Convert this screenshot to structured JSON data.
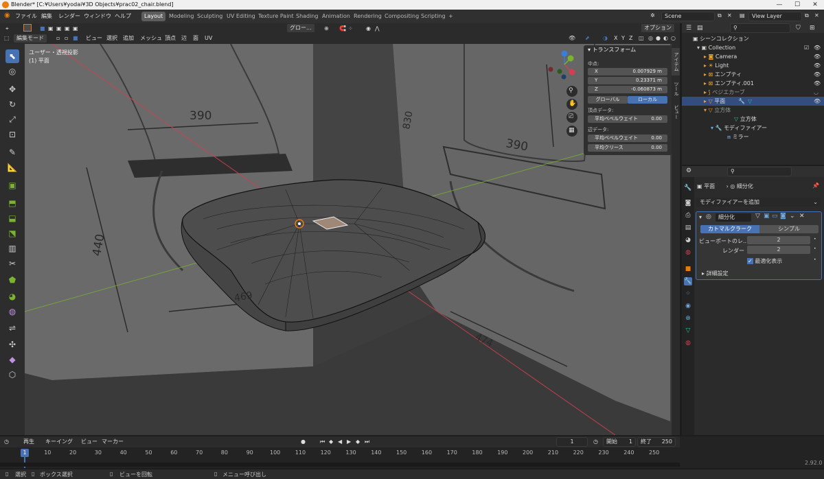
{
  "window": {
    "title": "Blender* [C:¥Users¥yodai¥3D Objects¥prac02_chair.blend]",
    "min": "—",
    "max": "☐",
    "close": "✕"
  },
  "menus": [
    "ファイル",
    "編集",
    "レンダー",
    "ウィンドウ",
    "ヘルプ"
  ],
  "workspaces": [
    "Layout",
    "Modeling",
    "Sculpting",
    "UV Editing",
    "Texture Paint",
    "Shading",
    "Animation",
    "Rendering",
    "Compositing",
    "Scripting",
    "+"
  ],
  "scene": {
    "name": "Scene",
    "view_layer": "View Layer"
  },
  "viewport_header": {
    "orientation": "グロー...",
    "options": "オプション",
    "axes": [
      "X",
      "Y",
      "Z"
    ],
    "mode": "編集モード",
    "menu": [
      "ビュー",
      "選択",
      "追加",
      "メッシュ",
      "頂点",
      "辺",
      "面",
      "UV"
    ]
  },
  "viewport": {
    "view_name": "ユーザー・透視投影",
    "object_name": "(1) 平面",
    "dims": [
      "390",
      "830",
      "390",
      "440",
      "469",
      "474"
    ]
  },
  "npanel": {
    "header": "トランスフォーム",
    "median": "中点:",
    "x_label": "X",
    "x": "0.007929 m",
    "y_label": "Y",
    "y": "0.23371 m",
    "z_label": "Z",
    "z": "-0.060873 m",
    "global": "グローバル",
    "local": "ローカル",
    "vertex_data": "頂点データ:",
    "bevel_weight_label": "平均ベベルウェイト",
    "bevel_weight_v": "0.00",
    "edge_data": "辺データ:",
    "edge_bevel_label": "平均ベベルウェイト",
    "edge_bevel_v": "0.00",
    "crease_label": "平均クリース",
    "crease_v": "0.00"
  },
  "side_tabs": [
    "アイテム",
    "ツール",
    "ビュー"
  ],
  "outliner": {
    "root": "シーンコレクション",
    "collection": "Collection",
    "items": [
      "Camera",
      "Light",
      "エンプティ",
      "エンプティ.001",
      "ベジエカーブ",
      "平面",
      "立方体",
      "立方体",
      "モディファイアー",
      "ミラー"
    ]
  },
  "properties": {
    "object": "平面",
    "modifier_name": "細分化",
    "add_modifier": "モディファイアーを追加",
    "mod_field": "細分化",
    "catmull": "カトマルクラーク",
    "simple": "シンプル",
    "viewport_levels_label": "ビューポートのレ...",
    "viewport_levels": "2",
    "render_label": "レンダー",
    "render": "2",
    "optimal": "最適化表示",
    "advanced": "詳細設定"
  },
  "timeline": {
    "playback": "再生",
    "keying": "キーイング",
    "view": "ビュー",
    "marker": "マーカー",
    "current": "1",
    "start_label": "開始",
    "start": "1",
    "end_label": "終了",
    "end": "250",
    "frame_marker": "1",
    "ticks": [
      "10",
      "20",
      "30",
      "40",
      "50",
      "60",
      "70",
      "80",
      "90",
      "100",
      "110",
      "120",
      "130",
      "140",
      "150",
      "160",
      "170",
      "180",
      "190",
      "200",
      "210",
      "220",
      "230",
      "240",
      "250"
    ]
  },
  "status": {
    "select": "選択",
    "box": "ボックス選択",
    "rotate": "ビューを回転",
    "menu": "メニュー呼び出し",
    "version": "2.92.0"
  },
  "colors": {
    "accent": "#4772b3",
    "selected_row": "#334d80",
    "orange": "#e87d0d",
    "x_axis": "#d04050",
    "y_axis": "#7ab32e",
    "z_axis": "#3a7fd6"
  }
}
